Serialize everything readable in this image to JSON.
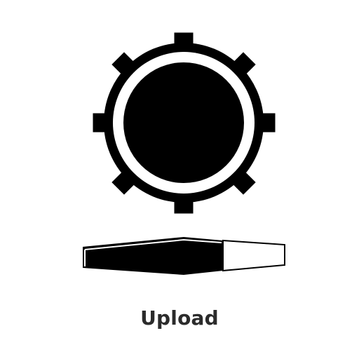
{
  "upload": {
    "label": "Upload",
    "icon": "gear-on-tray-icon"
  },
  "colors": {
    "icon": "#000000",
    "label": "#2b2b2b",
    "background": "#ffffff"
  }
}
